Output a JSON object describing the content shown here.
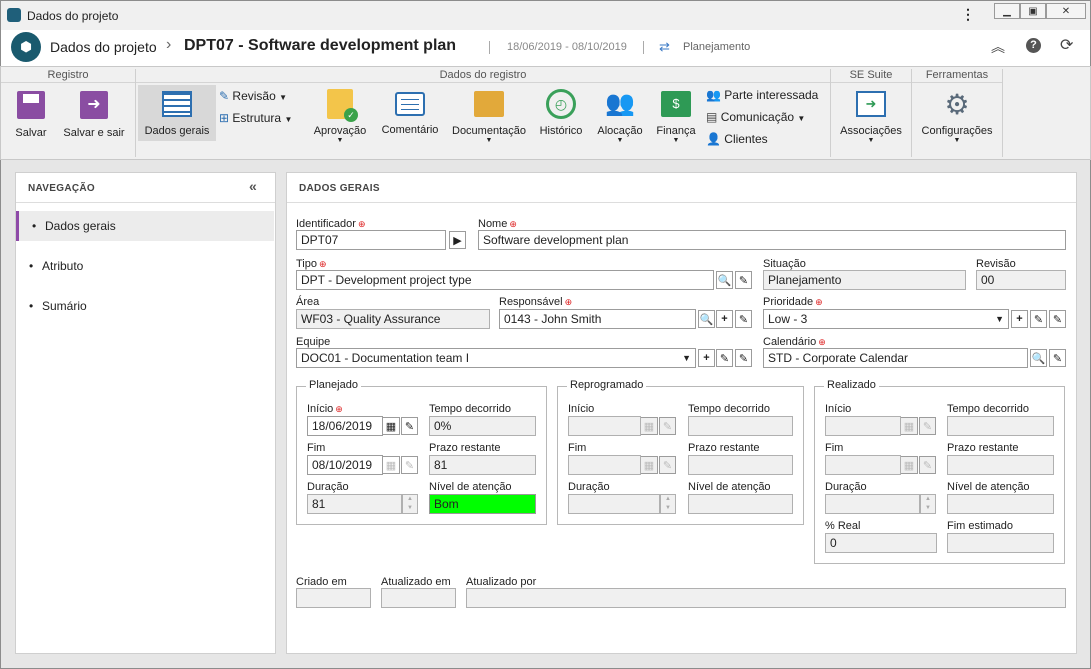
{
  "window": {
    "title": "Dados do projeto"
  },
  "header": {
    "app_title": "Dados do projeto",
    "separator": "›",
    "record_title": "DPT07 - Software development plan",
    "dates": "18/06/2019 - 08/10/2019",
    "status": "Planejamento"
  },
  "ribbon": {
    "groups": [
      "Registro",
      "Dados do registro",
      "SE Suite",
      "Ferramentas"
    ],
    "save": "Salvar",
    "save_exit": "Salvar e sair",
    "general": "Dados gerais",
    "revision": "Revisão",
    "structure": "Estrutura",
    "approval": "Aprovação",
    "comment": "Comentário",
    "documentation": "Documentação",
    "history": "Histórico",
    "allocation": "Alocação",
    "finance": "Finança",
    "stakeholder": "Parte interessada",
    "communication": "Comunicação",
    "clients": "Clientes",
    "associations": "Associações",
    "settings": "Configurações"
  },
  "nav": {
    "title": "NAVEGAÇÃO",
    "items": [
      "Dados gerais",
      "Atributo",
      "Sumário"
    ]
  },
  "form": {
    "title": "DADOS GERAIS",
    "identifier_label": "Identificador",
    "identifier": "DPT07",
    "name_label": "Nome",
    "name": "Software development plan",
    "type_label": "Tipo",
    "type": "DPT - Development project type",
    "situation_label": "Situação",
    "situation": "Planejamento",
    "revision_label": "Revisão",
    "revision": "00",
    "area_label": "Área",
    "area": "WF03 - Quality Assurance",
    "responsible_label": "Responsável",
    "responsible": "0143 - John Smith",
    "priority_label": "Prioridade",
    "priority": "Low - 3",
    "team_label": "Equipe",
    "team": "DOC01 - Documentation team I",
    "calendar_label": "Calendário",
    "calendar": "STD - Corporate Calendar",
    "planned": {
      "title": "Planejado",
      "start_label": "Início",
      "start": "18/06/2019",
      "elapsed_label": "Tempo decorrido",
      "elapsed": "0%",
      "end_label": "Fim",
      "end": "08/10/2019",
      "remaining_label": "Prazo restante",
      "remaining": "81",
      "duration_label": "Duração",
      "duration": "81",
      "attention_label": "Nível de atenção",
      "attention": "Bom",
      "attention_color": "#00ff00"
    },
    "rescheduled": {
      "title": "Reprogramado",
      "start_label": "Início",
      "elapsed_label": "Tempo decorrido",
      "end_label": "Fim",
      "remaining_label": "Prazo restante",
      "duration_label": "Duração",
      "attention_label": "Nível de atenção"
    },
    "realized": {
      "title": "Realizado",
      "start_label": "Início",
      "elapsed_label": "Tempo decorrido",
      "end_label": "Fim",
      "remaining_label": "Prazo restante",
      "duration_label": "Duração",
      "attention_label": "Nível de atenção",
      "real_label": "% Real",
      "real": "0",
      "end_est_label": "Fim estimado"
    },
    "created_label": "Criado em",
    "updated_label": "Atualizado em",
    "updated_by_label": "Atualizado por"
  }
}
